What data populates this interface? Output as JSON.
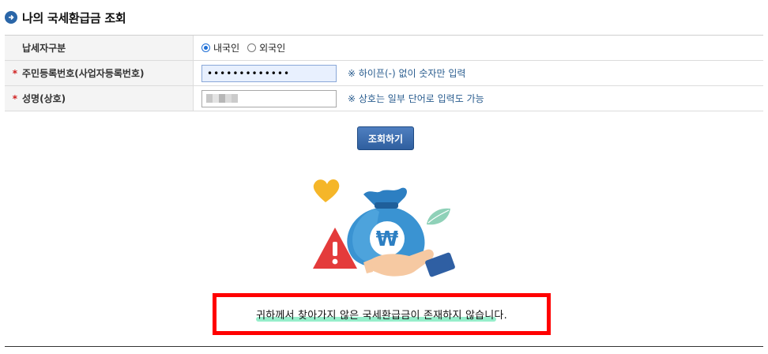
{
  "title": "나의 국세환급금 조회",
  "form": {
    "taxpayer_type": {
      "label": "납세자구분",
      "options": [
        "내국인",
        "외국인"
      ],
      "selected": "내국인"
    },
    "rrn": {
      "label": "주민등록번호(사업자등록번호)",
      "value": "•••••••••••••",
      "hint": "※ 하이픈(-) 없이 숫자만 입력"
    },
    "name": {
      "label": "성명(상호)",
      "value": "",
      "hint": "※ 상호는 일부 단어로 입력도 가능"
    }
  },
  "search_button": "조회하기",
  "result_message": "귀하께서 찾아가지 않은 국세환급금이 존재하지 않습니다.",
  "colors": {
    "accent_blue": "#2a66a8",
    "required_star": "#d02020",
    "hint_text": "#2a5d8f",
    "highlight_box": "#ff0000",
    "highlighter": "#3fe0a0"
  },
  "icons": [
    "arrow-circle-icon",
    "money-bag-illustration",
    "warning-triangle-icon",
    "heart-icon",
    "leaf-icon"
  ]
}
